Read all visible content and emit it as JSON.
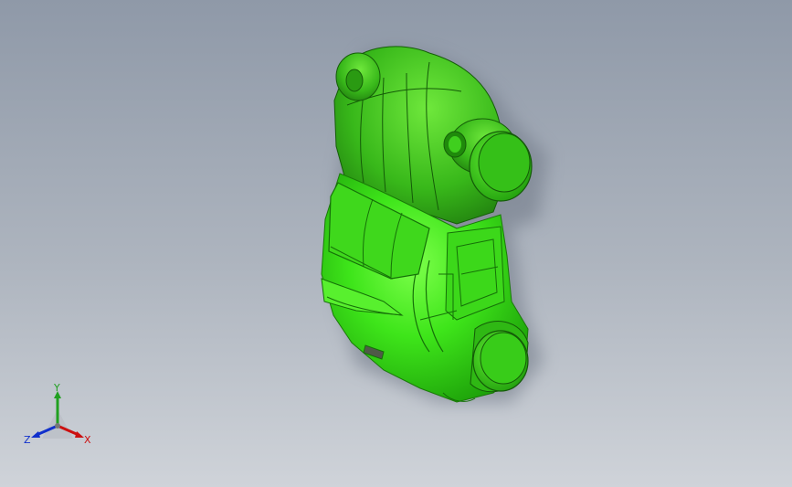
{
  "viewport": {
    "background_top": "#8f99a8",
    "background_bottom": "#cfd3d9",
    "model": {
      "color": "#33dd11",
      "dark_color": "#1b8a0a",
      "shadow_color": "#6e7785"
    }
  },
  "triad": {
    "x_label": "X",
    "y_label": "Y",
    "z_label": "Z",
    "x_color": "#cc1010",
    "y_color": "#20a020",
    "z_color": "#1030cc"
  }
}
